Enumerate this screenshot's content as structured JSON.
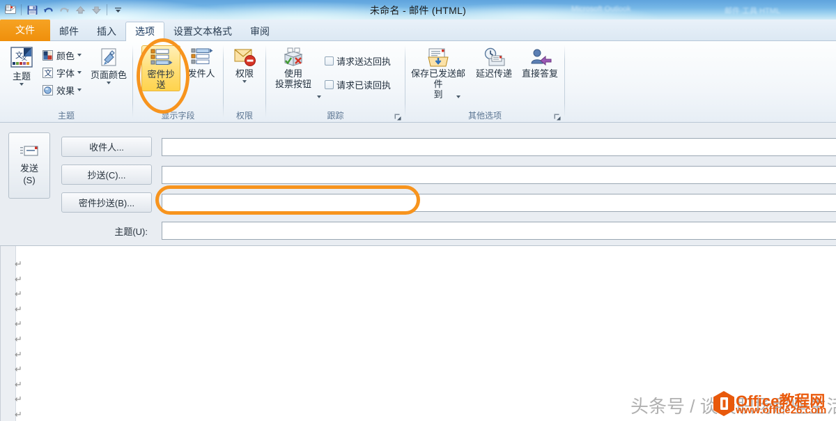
{
  "window": {
    "title": "未命名 - 邮件 (HTML)",
    "ghost_left": "Microsoft Outlook",
    "ghost_right": "邮件 工具 HTML"
  },
  "quick_access": {
    "items": [
      {
        "name": "outlook-icon",
        "label": "Outlook"
      },
      {
        "name": "save-icon",
        "label": "保存"
      },
      {
        "name": "undo-icon",
        "label": "撤消"
      },
      {
        "name": "redo-icon",
        "label": "恢复"
      },
      {
        "name": "previous-item-icon",
        "label": "上一项"
      },
      {
        "name": "next-item-icon",
        "label": "下一项"
      },
      {
        "name": "customize-qat-icon",
        "label": "自定义快速访问工具栏"
      }
    ]
  },
  "ribbon": {
    "tabs": [
      {
        "label": "文件",
        "kind": "file"
      },
      {
        "label": "邮件",
        "kind": "normal"
      },
      {
        "label": "插入",
        "kind": "normal"
      },
      {
        "label": "选项",
        "kind": "active"
      },
      {
        "label": "设置文本格式",
        "kind": "normal"
      },
      {
        "label": "审阅",
        "kind": "normal"
      }
    ],
    "groups": {
      "theme": {
        "label": "主题",
        "theme_button": "主题",
        "colors": "颜色",
        "fonts": "字体",
        "effects": "效果",
        "page_color": "页面颜色"
      },
      "show_fields": {
        "label": "显示字段",
        "bcc": "密件抄送",
        "from": "发件人"
      },
      "permission": {
        "label": "权限",
        "permission": "权限"
      },
      "tracking": {
        "label": "跟踪",
        "use_voting_buttons": "使用\n投票按钮",
        "use_voting_line1": "使用",
        "use_voting_line2": "投票按钮",
        "request_delivery_receipt": "请求送达回执",
        "request_read_receipt": "请求已读回执"
      },
      "more_options": {
        "label": "其他选项",
        "save_sent_item_line1": "保存已发送邮件",
        "save_sent_item_line2": "到",
        "delay_delivery": "延迟传递",
        "direct_replies_to": "直接答复"
      }
    }
  },
  "compose": {
    "send_button_line1": "发送",
    "send_button_line2": "(S)",
    "fields": [
      {
        "button_label": "收件人...",
        "value": "",
        "name": "to"
      },
      {
        "button_label": "抄送(C)...",
        "value": "",
        "name": "cc"
      },
      {
        "button_label": "密件抄送(B)...",
        "value": "",
        "name": "bcc"
      }
    ],
    "subject_label": "主题(U):",
    "subject_value": ""
  },
  "body": {
    "paragraph_mark": "↵",
    "paragraph_count": 11
  },
  "annotations": {
    "color": "#f7941e",
    "bcc_ribbon_highlight": "密件抄送",
    "bcc_field_highlight": "密件抄送输入框"
  },
  "watermark": {
    "byline": "头条号 / 谈谈职场那些生活",
    "brand": "Office教程网",
    "url": "www.office26.com"
  }
}
